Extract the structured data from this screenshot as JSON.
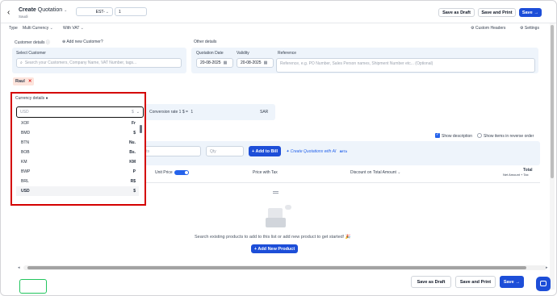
{
  "header": {
    "back_icon": "chevron-left-icon",
    "title_bold": "Create",
    "title_rest": "Quotation",
    "subtitle": "Saudi",
    "doc_prefix": "EST-",
    "doc_number": "1",
    "save_draft": "Save as Draft",
    "save_print": "Save and Print",
    "save": "Save"
  },
  "toolbar": {
    "type_label": "Type",
    "type_value": "Multi Currency",
    "vat_value": "With VAT",
    "custom_headers": "Custom Headers",
    "settings": "Settings"
  },
  "customer": {
    "heading": "Customer details",
    "add_new": "Add new Customer?",
    "select_label": "Select Customer",
    "search_placeholder": "Search your Customers, Company Name, VAT Number, tags...",
    "chip": "Raul"
  },
  "other": {
    "heading": "Other details",
    "quotation_date_label": "Quotation Date",
    "quotation_date": "20-08-2025",
    "validity_label": "Validity",
    "validity_date": "20-08-2025",
    "reference_label": "Reference",
    "reference_placeholder": "Reference, e.g. PO Number, Sales Person names, Shipment Number etc... (Optional)"
  },
  "currency": {
    "heading": "Currency details",
    "input_value": "USD",
    "input_symbol": "$",
    "conversion_text": "Conversion rate 1 $ =",
    "conversion_value": "1",
    "conversion_currency": "SAR",
    "options": [
      {
        "code": "XOF",
        "symbol": "Fr"
      },
      {
        "code": "BMD",
        "symbol": "$"
      },
      {
        "code": "BTN",
        "symbol": "Nu."
      },
      {
        "code": "BOB",
        "symbol": "Bs."
      },
      {
        "code": "KM",
        "symbol": "KM"
      },
      {
        "code": "BWP",
        "symbol": "P"
      },
      {
        "code": "BRL",
        "symbol": "R$"
      },
      {
        "code": "USD",
        "symbol": "$"
      }
    ]
  },
  "products": {
    "show_description": "Show description",
    "show_reverse": "Show items in reverse order",
    "search_placeholder": "ucts",
    "qty_placeholder": "Qty",
    "add_to_bill": "+ Add to Bill",
    "ai_link": "Create Quotations with AI",
    "ai_badge": "BETA",
    "unit_price": "Unit Price",
    "price_with_tax": "Price with Tax",
    "discount_on": "Discount on",
    "discount_select": "Total Amount",
    "total": "Total",
    "total_sub": "Net Amount + Tax",
    "empty_text": "Search existing products to add to this list or add new product to get started! 🎉",
    "add_new_product": "+ Add New Product"
  },
  "footer": {
    "save_draft": "Save as Draft",
    "save_print": "Save and Print",
    "save": "Save"
  },
  "colors": {
    "primary": "#1d4ed8",
    "highlight_border": "#d40000",
    "panel_bg": "#eef4fb"
  }
}
